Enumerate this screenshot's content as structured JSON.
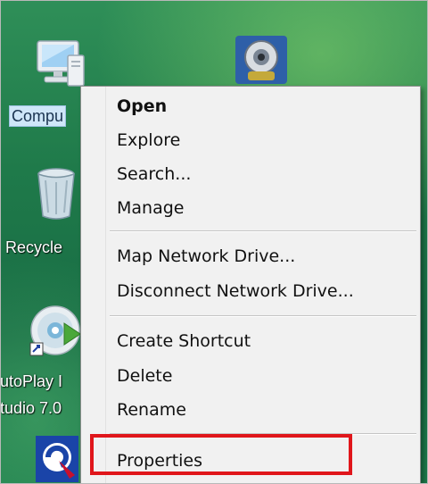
{
  "desktop": {
    "icons": {
      "computer": {
        "label": "Compu",
        "selected": true
      },
      "recycle_bin": {
        "label": "Recycle"
      },
      "autoplay": {
        "label_line1": "utoPlay I",
        "label_line2": "tudio 7.0"
      }
    }
  },
  "context_menu": {
    "items": [
      {
        "label": "Open",
        "bold": true
      },
      {
        "label": "Explore"
      },
      {
        "label": "Search..."
      },
      {
        "label": "Manage"
      },
      {
        "label": "Map Network Drive..."
      },
      {
        "label": "Disconnect Network Drive..."
      },
      {
        "label": "Create Shortcut"
      },
      {
        "label": "Delete"
      },
      {
        "label": "Rename"
      },
      {
        "label": "Properties",
        "highlighted": true
      }
    ],
    "highlight_color": "#e0161b"
  }
}
